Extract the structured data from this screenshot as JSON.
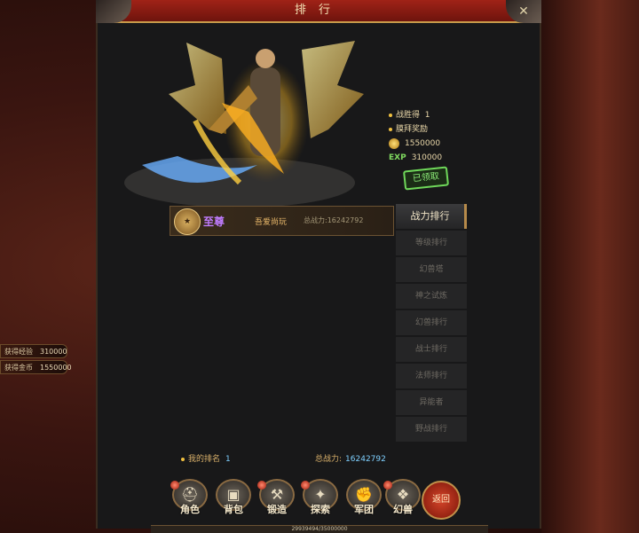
{
  "window": {
    "title": "排行"
  },
  "side_info": [
    {
      "label": "获得经验",
      "value": "310000"
    },
    {
      "label": "获得金币",
      "value": "1550000"
    }
  ],
  "reward": {
    "line1_label": "战胜得",
    "line1_value": "1",
    "line2_label": "膜拜奖励",
    "gold": "1550000",
    "exp_label": "EXP",
    "exp": "310000",
    "claimed": "已领取"
  },
  "top_player": {
    "title": "至尊",
    "name": "吾爱尚玩",
    "power_label": "总战力:",
    "power": "16242792"
  },
  "tabs": [
    "战力排行",
    "等级排行",
    "幻兽塔",
    "神之试炼",
    "幻兽排行",
    "战士排行",
    "法师排行",
    "异能者",
    "野战排行"
  ],
  "my_rank": {
    "label": "我的排名",
    "value": "1"
  },
  "my_power": {
    "label": "总战力:",
    "value": "16242792"
  },
  "bottom_nav": [
    "角色",
    "背包",
    "锻造",
    "探索",
    "军团",
    "幻兽"
  ],
  "back_label": "返回",
  "exp_text": "29939494/35000000"
}
